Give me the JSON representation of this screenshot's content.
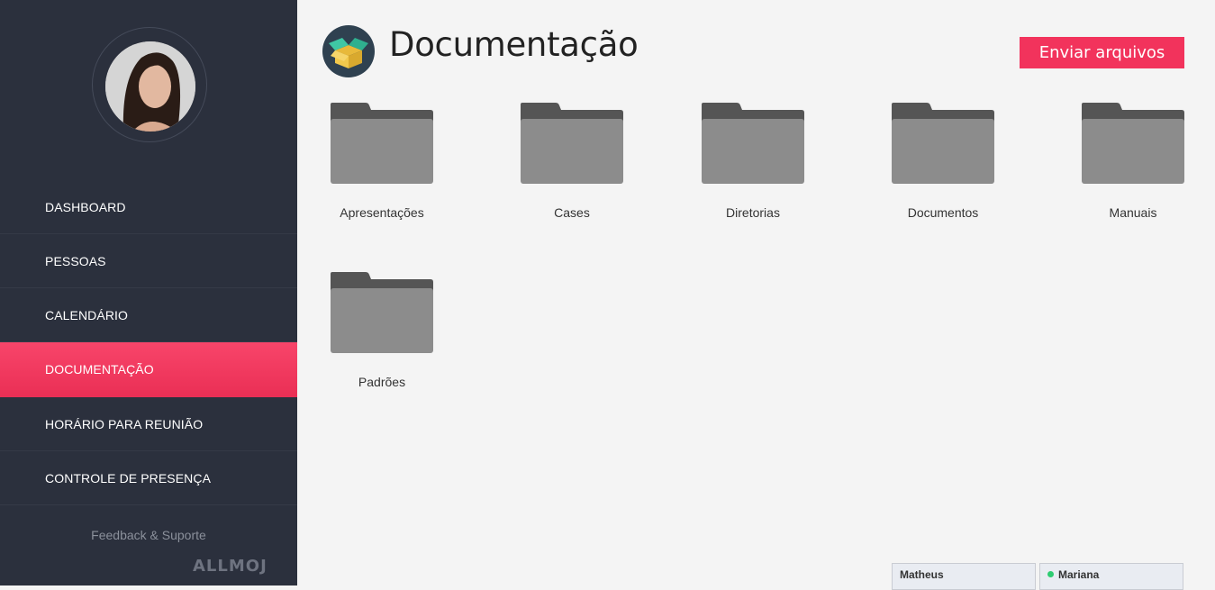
{
  "sidebar": {
    "nav": [
      {
        "label": "DASHBOARD"
      },
      {
        "label": "PESSOAS"
      },
      {
        "label": "CALENDÁRIO"
      },
      {
        "label": "DOCUMENTAÇÃO",
        "active": true
      },
      {
        "label": "HORÁRIO PARA REUNIÃO"
      },
      {
        "label": "CONTROLE DE PRESENÇA"
      }
    ],
    "feedback_label": "Feedback & Suporte",
    "brand": "ALLMOJ"
  },
  "header": {
    "title": "Documentação",
    "upload_label": "Enviar arquivos",
    "icon": "open-box-icon"
  },
  "folders": [
    {
      "name": "Apresentações"
    },
    {
      "name": "Cases"
    },
    {
      "name": "Diretorias"
    },
    {
      "name": "Documentos"
    },
    {
      "name": "Manuais"
    },
    {
      "name": "Padrões"
    }
  ],
  "chat": [
    {
      "name": "Matheus",
      "online": false
    },
    {
      "name": "Mariana",
      "online": true
    }
  ],
  "colors": {
    "sidebar_bg": "#2b303d",
    "accent": "#f2335c",
    "folder": "#8c8c8c",
    "online": "#2ecc71"
  }
}
